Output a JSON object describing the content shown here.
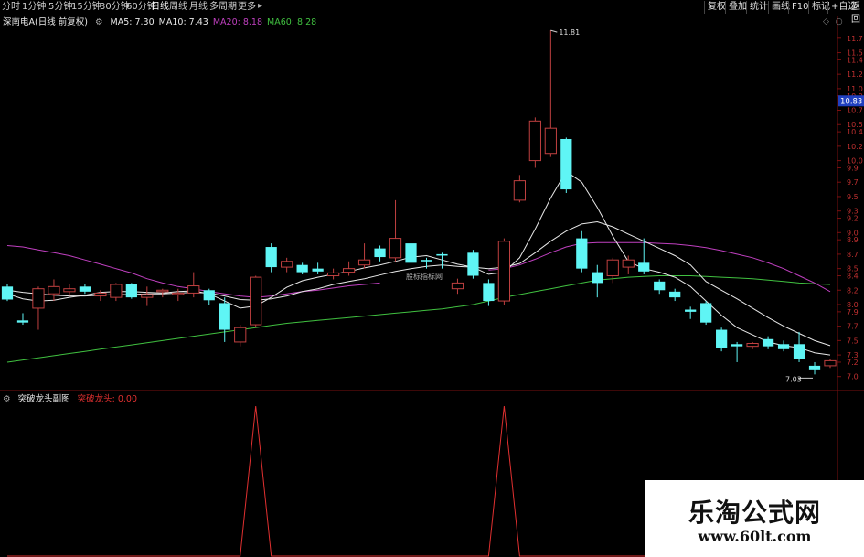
{
  "toolbar": {
    "periods": [
      "分时",
      "1分钟",
      "5分钟",
      "15分钟",
      "30分钟",
      "60分钟",
      "日线",
      "周线",
      "月线",
      "多周期",
      "更多"
    ],
    "active_period": "日线",
    "right_buttons": [
      "复权",
      "叠加",
      "统计",
      "画线",
      "F10",
      "标记",
      "+自选",
      "返回"
    ]
  },
  "price_panel": {
    "stock_label": "深南电A(日线 前复权)",
    "ma_legend": [
      {
        "text": "MA5: 7.30",
        "color": "#e8e8e8"
      },
      {
        "text": "MA10: 7.43",
        "color": "#e8e8e8"
      },
      {
        "text": "MA20: 8.18",
        "color": "#c040c0"
      },
      {
        "text": "MA60: 8.28",
        "color": "#40c040"
      }
    ],
    "current_price_tag": "10.83",
    "high_annotation": "11.81",
    "low_annotation": "7.03",
    "inline_watermark": "股标指标网"
  },
  "indicator_panel": {
    "title": "突破龙头副图",
    "legend": "突破龙头: 0.00",
    "legend_color": "#e03030"
  },
  "watermark": {
    "cn": "乐淘公式网",
    "url": "www.60lt.com"
  },
  "colors": {
    "up": "#c04040",
    "down": "#5ff5f5",
    "ma5": "#e8e8e8",
    "ma10": "#e8e8e8",
    "ma20": "#c040c0",
    "ma60": "#40c040",
    "grid": "#7a1010",
    "signal": "#e03030"
  },
  "chart_data": {
    "type": "candlestick",
    "y_axis_ticks": [
      7.0,
      7.2,
      7.3,
      7.5,
      7.7,
      7.9,
      8.0,
      8.2,
      8.4,
      8.5,
      8.7,
      8.9,
      9.0,
      9.2,
      9.3,
      9.5,
      9.7,
      9.9,
      10.0,
      10.2,
      10.4,
      10.5,
      10.7,
      10.9,
      11.0,
      11.2,
      11.4,
      11.5,
      11.7
    ],
    "ylim": [
      6.92,
      11.85
    ],
    "candles": [
      {
        "o": 8.25,
        "h": 8.28,
        "l": 8.05,
        "c": 8.07
      },
      {
        "o": 7.78,
        "h": 7.88,
        "l": 7.72,
        "c": 7.75
      },
      {
        "o": 7.95,
        "h": 8.25,
        "l": 7.65,
        "c": 8.22
      },
      {
        "o": 8.15,
        "h": 8.35,
        "l": 8.05,
        "c": 8.25
      },
      {
        "o": 8.18,
        "h": 8.28,
        "l": 8.12,
        "c": 8.22
      },
      {
        "o": 8.25,
        "h": 8.28,
        "l": 8.15,
        "c": 8.18
      },
      {
        "o": 8.12,
        "h": 8.2,
        "l": 8.05,
        "c": 8.16
      },
      {
        "o": 8.1,
        "h": 8.3,
        "l": 8.05,
        "c": 8.28
      },
      {
        "o": 8.28,
        "h": 8.3,
        "l": 8.08,
        "c": 8.1
      },
      {
        "o": 8.1,
        "h": 8.25,
        "l": 7.98,
        "c": 8.14
      },
      {
        "o": 8.18,
        "h": 8.22,
        "l": 8.1,
        "c": 8.2
      },
      {
        "o": 8.15,
        "h": 8.22,
        "l": 8.05,
        "c": 8.16
      },
      {
        "o": 8.16,
        "h": 8.45,
        "l": 8.1,
        "c": 8.26
      },
      {
        "o": 8.2,
        "h": 8.22,
        "l": 8.0,
        "c": 8.06
      },
      {
        "o": 8.02,
        "h": 8.1,
        "l": 7.48,
        "c": 7.65
      },
      {
        "o": 7.48,
        "h": 7.72,
        "l": 7.42,
        "c": 7.68
      },
      {
        "o": 7.72,
        "h": 8.4,
        "l": 7.68,
        "c": 8.38
      },
      {
        "o": 8.8,
        "h": 8.85,
        "l": 8.45,
        "c": 8.52
      },
      {
        "o": 8.52,
        "h": 8.65,
        "l": 8.45,
        "c": 8.6
      },
      {
        "o": 8.55,
        "h": 8.58,
        "l": 8.42,
        "c": 8.45
      },
      {
        "o": 8.5,
        "h": 8.58,
        "l": 8.42,
        "c": 8.46
      },
      {
        "o": 8.4,
        "h": 8.5,
        "l": 8.35,
        "c": 8.44
      },
      {
        "o": 8.45,
        "h": 8.6,
        "l": 8.4,
        "c": 8.5
      },
      {
        "o": 8.55,
        "h": 8.85,
        "l": 8.5,
        "c": 8.62
      },
      {
        "o": 8.78,
        "h": 8.82,
        "l": 8.6,
        "c": 8.66
      },
      {
        "o": 8.65,
        "h": 9.45,
        "l": 8.6,
        "c": 8.92
      },
      {
        "o": 8.85,
        "h": 8.88,
        "l": 8.55,
        "c": 8.58
      },
      {
        "o": 8.62,
        "h": 8.65,
        "l": 8.5,
        "c": 8.6
      },
      {
        "o": 8.7,
        "h": 8.72,
        "l": 8.5,
        "c": 8.68
      },
      {
        "o": 8.22,
        "h": 8.36,
        "l": 8.15,
        "c": 8.3
      },
      {
        "o": 8.72,
        "h": 8.76,
        "l": 8.36,
        "c": 8.4
      },
      {
        "o": 8.3,
        "h": 8.35,
        "l": 7.98,
        "c": 8.05
      },
      {
        "o": 8.05,
        "h": 8.92,
        "l": 8.0,
        "c": 8.88
      },
      {
        "o": 9.45,
        "h": 9.8,
        "l": 9.42,
        "c": 9.72
      },
      {
        "o": 10.0,
        "h": 10.6,
        "l": 9.9,
        "c": 10.55
      },
      {
        "o": 10.1,
        "h": 11.81,
        "l": 10.05,
        "c": 10.45
      },
      {
        "o": 10.3,
        "h": 10.32,
        "l": 9.55,
        "c": 9.6
      },
      {
        "o": 8.92,
        "h": 9.02,
        "l": 8.45,
        "c": 8.5
      },
      {
        "o": 8.45,
        "h": 8.55,
        "l": 8.1,
        "c": 8.3
      },
      {
        "o": 8.4,
        "h": 8.65,
        "l": 8.3,
        "c": 8.62
      },
      {
        "o": 8.52,
        "h": 8.68,
        "l": 8.42,
        "c": 8.62
      },
      {
        "o": 8.58,
        "h": 8.92,
        "l": 8.42,
        "c": 8.46
      },
      {
        "o": 8.32,
        "h": 8.35,
        "l": 8.15,
        "c": 8.2
      },
      {
        "o": 8.18,
        "h": 8.22,
        "l": 8.05,
        "c": 8.1
      },
      {
        "o": 7.93,
        "h": 7.97,
        "l": 7.8,
        "c": 7.9
      },
      {
        "o": 8.02,
        "h": 8.05,
        "l": 7.72,
        "c": 7.75
      },
      {
        "o": 7.65,
        "h": 7.68,
        "l": 7.35,
        "c": 7.4
      },
      {
        "o": 7.45,
        "h": 7.48,
        "l": 7.2,
        "c": 7.42
      },
      {
        "o": 7.42,
        "h": 7.48,
        "l": 7.38,
        "c": 7.46
      },
      {
        "o": 7.52,
        "h": 7.56,
        "l": 7.38,
        "c": 7.42
      },
      {
        "o": 7.45,
        "h": 7.5,
        "l": 7.35,
        "c": 7.38
      },
      {
        "o": 7.45,
        "h": 7.62,
        "l": 7.2,
        "c": 7.25
      },
      {
        "o": 7.15,
        "h": 7.2,
        "l": 7.03,
        "c": 7.1
      },
      {
        "o": 7.15,
        "h": 7.25,
        "l": 7.12,
        "c": 7.22
      }
    ],
    "ma5": [
      8.15,
      8.08,
      8.05,
      8.06,
      8.1,
      8.13,
      8.17,
      8.18,
      8.18,
      8.17,
      8.16,
      8.18,
      8.19,
      8.15,
      8.05,
      7.95,
      7.98,
      8.1,
      8.24,
      8.33,
      8.38,
      8.42,
      8.46,
      8.51,
      8.55,
      8.6,
      8.66,
      8.68,
      8.62,
      8.56,
      8.52,
      8.42,
      8.45,
      8.65,
      9.05,
      9.48,
      9.85,
      9.7,
      9.35,
      8.95,
      8.6,
      8.5,
      8.45,
      8.38,
      8.25,
      8.05,
      7.85,
      7.68,
      7.58,
      7.48,
      7.43,
      7.4,
      7.33,
      7.3
    ],
    "ma10": [
      8.2,
      8.17,
      8.15,
      8.13,
      8.12,
      8.12,
      8.13,
      8.14,
      8.14,
      8.15,
      8.15,
      8.16,
      8.17,
      8.16,
      8.12,
      8.07,
      8.06,
      8.08,
      8.12,
      8.18,
      8.22,
      8.28,
      8.32,
      8.36,
      8.41,
      8.46,
      8.5,
      8.53,
      8.55,
      8.53,
      8.52,
      8.5,
      8.52,
      8.57,
      8.72,
      8.88,
      9.02,
      9.12,
      9.15,
      9.08,
      8.98,
      8.88,
      8.78,
      8.68,
      8.55,
      8.32,
      8.2,
      8.08,
      7.95,
      7.82,
      7.7,
      7.6,
      7.5,
      7.43
    ],
    "ma20": [
      8.82,
      8.8,
      8.76,
      8.72,
      8.68,
      8.62,
      8.56,
      8.5,
      8.44,
      8.36,
      8.3,
      8.25,
      8.22,
      8.18,
      8.15,
      8.12,
      8.1,
      8.12,
      8.15,
      8.18,
      8.2,
      8.23,
      8.26,
      8.28,
      8.3,
      null,
      null,
      null,
      null,
      null,
      null,
      8.48,
      8.5,
      8.55,
      8.63,
      8.72,
      8.8,
      8.85,
      8.86,
      8.86,
      8.86,
      8.86,
      8.85,
      8.84,
      8.82,
      8.79,
      8.75,
      8.7,
      8.65,
      8.58,
      8.5,
      8.4,
      8.3,
      8.18
    ],
    "ma60": [
      7.2,
      7.23,
      7.26,
      7.29,
      7.32,
      7.35,
      7.38,
      7.41,
      7.44,
      7.47,
      7.5,
      7.53,
      7.56,
      7.59,
      7.62,
      7.65,
      7.68,
      7.71,
      7.74,
      7.76,
      7.78,
      7.8,
      7.82,
      7.84,
      7.86,
      7.88,
      7.9,
      7.92,
      7.94,
      7.97,
      8.0,
      8.05,
      8.1,
      8.14,
      8.18,
      8.22,
      8.26,
      8.3,
      8.34,
      8.36,
      8.38,
      8.39,
      8.4,
      8.4,
      8.4,
      8.39,
      8.38,
      8.37,
      8.36,
      8.34,
      8.32,
      8.3,
      8.29,
      8.28
    ],
    "indicator_signal": [
      0,
      0,
      0,
      0,
      0,
      0,
      0,
      0,
      0,
      0,
      0,
      0,
      0,
      0,
      0,
      0,
      1,
      0,
      0,
      0,
      0,
      0,
      0,
      0,
      0,
      0,
      0,
      0,
      0,
      0,
      0,
      0,
      1,
      0,
      0,
      0,
      0,
      0,
      0,
      0,
      0,
      0,
      0,
      0,
      0,
      0,
      0,
      0,
      0,
      0,
      0,
      0,
      0,
      0
    ]
  }
}
